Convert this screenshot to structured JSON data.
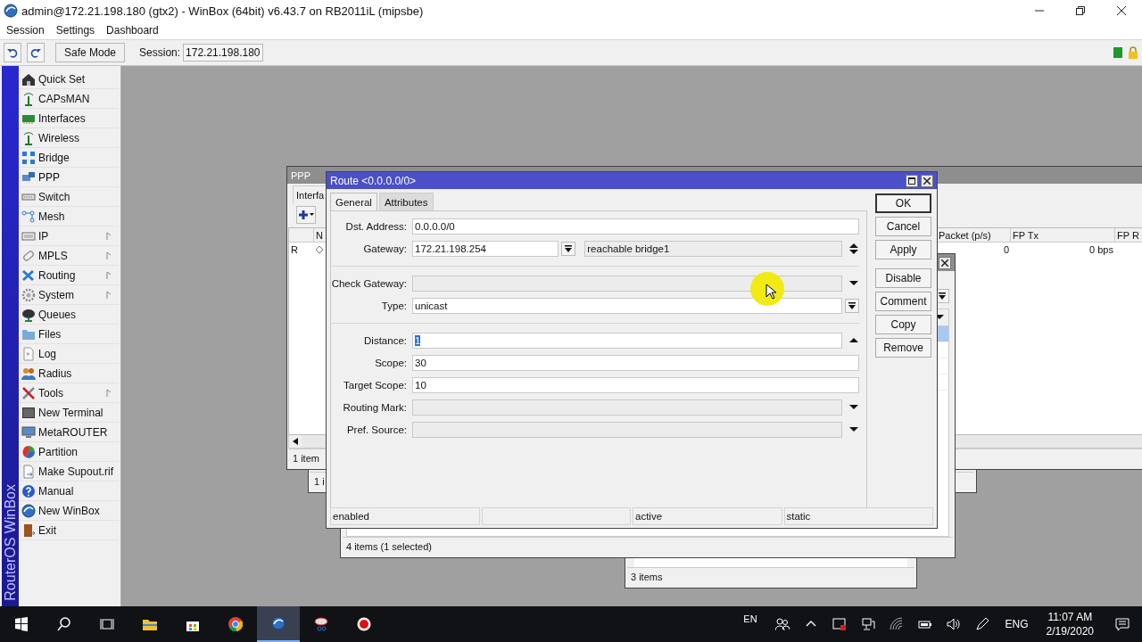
{
  "window": {
    "title": "admin@172.21.198.180 (gtx2) - WinBox (64bit) v6.43.7 on RB2011iL (mipsbe)"
  },
  "menu": [
    "Session",
    "Settings",
    "Dashboard"
  ],
  "toolbar": {
    "safe_mode": {
      "label": "Safe Mode",
      "on": false
    },
    "session_label": "Session:",
    "session_value": "172.21.198.180"
  },
  "sidebar": {
    "brand": "RouterOS WinBox",
    "items": [
      {
        "label": "Quick Set",
        "submenu": false
      },
      {
        "label": "CAPsMAN",
        "submenu": false
      },
      {
        "label": "Interfaces",
        "submenu": false
      },
      {
        "label": "Wireless",
        "submenu": false
      },
      {
        "label": "Bridge",
        "submenu": false
      },
      {
        "label": "PPP",
        "submenu": false
      },
      {
        "label": "Switch",
        "submenu": false
      },
      {
        "label": "Mesh",
        "submenu": false
      },
      {
        "label": "IP",
        "submenu": true
      },
      {
        "label": "MPLS",
        "submenu": true
      },
      {
        "label": "Routing",
        "submenu": true
      },
      {
        "label": "System",
        "submenu": true
      },
      {
        "label": "Queues",
        "submenu": false
      },
      {
        "label": "Files",
        "submenu": false
      },
      {
        "label": "Log",
        "submenu": false
      },
      {
        "label": "Radius",
        "submenu": false
      },
      {
        "label": "Tools",
        "submenu": true
      },
      {
        "label": "New Terminal",
        "submenu": false
      },
      {
        "label": "MetaROUTER",
        "submenu": false
      },
      {
        "label": "Partition",
        "submenu": false
      },
      {
        "label": "Make Supout.rif",
        "submenu": false
      },
      {
        "label": "Manual",
        "submenu": false
      },
      {
        "label": "New WinBox",
        "submenu": false
      },
      {
        "label": "Exit",
        "submenu": false
      }
    ]
  },
  "ppp_window": {
    "title": "PPP",
    "tab": "Interfa",
    "columns": [
      {
        "label": "N"
      },
      {
        "label": "Packet (p/s)"
      },
      {
        "label": "FP Tx"
      },
      {
        "label": "FP R"
      }
    ],
    "row": {
      "flag": "R",
      "packet": "0",
      "fp_tx": "0 bps"
    },
    "status": "1 item"
  },
  "lower_window": {
    "status": "1 i"
  },
  "routes_window": {
    "rows": [
      {
        "selected": true
      },
      {
        "selected": false
      },
      {
        "selected": false
      },
      {
        "selected": false
      }
    ],
    "status": "4 items (1 selected)"
  },
  "third_window": {
    "status": "3 items"
  },
  "route_dialog": {
    "title": "Route <0.0.0.0/0>",
    "tabs": [
      {
        "label": "General",
        "selected": true
      },
      {
        "label": "Attributes",
        "selected": false
      }
    ],
    "field_groups": [
      [
        {
          "kind": "text",
          "label": "Dst. Address:",
          "value": "0.0.0.0/0"
        },
        {
          "kind": "gateway",
          "label": "Gateway:",
          "value": "172.21.198.254",
          "state": "reachable bridge1"
        }
      ],
      [
        {
          "kind": "combo",
          "label": "Check Gateway:"
        },
        {
          "kind": "select",
          "label": "Type:",
          "value": "unicast"
        }
      ],
      [
        {
          "kind": "spin",
          "label": "Distance:",
          "value": "1",
          "value_selected": true
        },
        {
          "kind": "text",
          "label": "Scope:",
          "value": "30"
        },
        {
          "kind": "text",
          "label": "Target Scope:",
          "value": "10"
        },
        {
          "kind": "combo",
          "label": "Routing Mark:"
        },
        {
          "kind": "combo",
          "label": "Pref. Source:"
        }
      ]
    ],
    "button_groups": [
      [
        {
          "label": "OK",
          "default": true
        },
        {
          "label": "Cancel",
          "default": false
        },
        {
          "label": "Apply",
          "default": false
        }
      ],
      [
        {
          "label": "Disable",
          "default": false
        },
        {
          "label": "Comment",
          "default": false
        },
        {
          "label": "Copy",
          "default": false
        },
        {
          "label": "Remove",
          "default": false
        }
      ]
    ],
    "status_bar": {
      "cell_1": "enabled",
      "cell_3": "active",
      "cell_4": "static"
    }
  },
  "taskbar": {
    "apps": [
      {
        "kind": "start",
        "active": false
      },
      {
        "kind": "search",
        "active": false
      },
      {
        "kind": "task_view",
        "active": false
      },
      {
        "kind": "explorer",
        "active": false
      },
      {
        "kind": "store",
        "active": false
      },
      {
        "kind": "chrome",
        "active": false
      },
      {
        "kind": "winbox",
        "active": true
      },
      {
        "kind": "snipping",
        "active": false
      },
      {
        "kind": "recorder",
        "active": false
      }
    ],
    "input_indicator": "EN",
    "language": "ENG",
    "time": "11:07 AM",
    "date": "2/19/2020"
  }
}
